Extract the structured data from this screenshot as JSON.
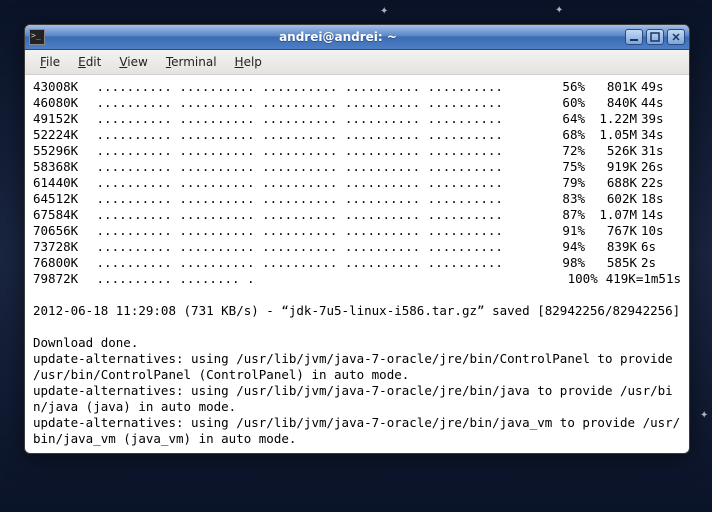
{
  "window": {
    "title": "andrei@andrei: ~"
  },
  "menu": {
    "file": "File",
    "edit": "Edit",
    "view": "View",
    "terminal": "Terminal",
    "help": "Help"
  },
  "dots": ".......... .......... .......... .......... ..........",
  "dots_last": ".......... ........ .",
  "progress": [
    {
      "size": "43008K",
      "pct": "56%",
      "spd": "801K",
      "eta": "49s"
    },
    {
      "size": "46080K",
      "pct": "60%",
      "spd": "840K",
      "eta": "44s"
    },
    {
      "size": "49152K",
      "pct": "64%",
      "spd": "1.22M",
      "eta": "39s"
    },
    {
      "size": "52224K",
      "pct": "68%",
      "spd": "1.05M",
      "eta": "34s"
    },
    {
      "size": "55296K",
      "pct": "72%",
      "spd": "526K",
      "eta": "31s"
    },
    {
      "size": "58368K",
      "pct": "75%",
      "spd": "919K",
      "eta": "26s"
    },
    {
      "size": "61440K",
      "pct": "79%",
      "spd": "688K",
      "eta": "22s"
    },
    {
      "size": "64512K",
      "pct": "83%",
      "spd": "602K",
      "eta": "18s"
    },
    {
      "size": "67584K",
      "pct": "87%",
      "spd": "1.07M",
      "eta": "14s"
    },
    {
      "size": "70656K",
      "pct": "91%",
      "spd": "767K",
      "eta": "10s"
    },
    {
      "size": "73728K",
      "pct": "94%",
      "spd": "839K",
      "eta": "6s"
    },
    {
      "size": "76800K",
      "pct": "98%",
      "spd": "585K",
      "eta": "2s"
    }
  ],
  "progress_last": {
    "size": "79872K",
    "pct": "100%",
    "tail": "419K=1m51s"
  },
  "lines": {
    "blank": " ",
    "saved": "2012-06-18 11:29:08 (731 KB/s) - “jdk-7u5-linux-i586.tar.gz” saved [82942256/82942256]",
    "done": "Download done.",
    "alt1": "update-alternatives: using /usr/lib/jvm/java-7-oracle/jre/bin/ControlPanel to provide /usr/bin/ControlPanel (ControlPanel) in auto mode.",
    "alt2": "update-alternatives: using /usr/lib/jvm/java-7-oracle/jre/bin/java to provide /usr/bin/java (java) in auto mode.",
    "alt3": "update-alternatives: using /usr/lib/jvm/java-7-oracle/jre/bin/java_vm to provide /usr/bin/java_vm (java_vm) in auto mode."
  }
}
